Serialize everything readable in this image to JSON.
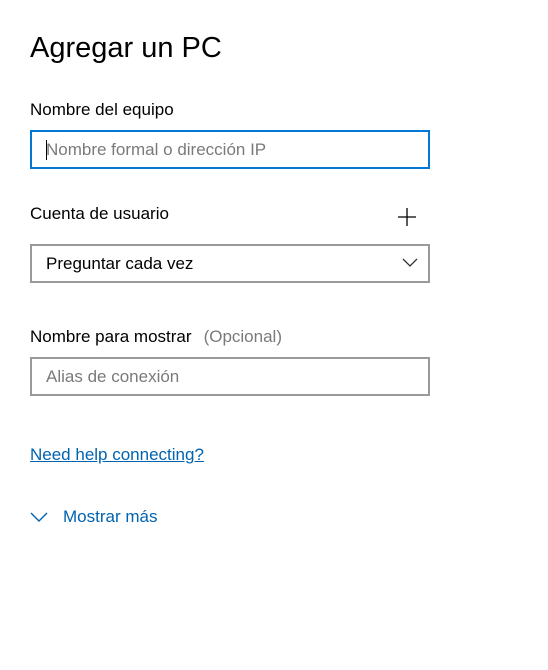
{
  "page": {
    "title": "Agregar un PC"
  },
  "pc_name": {
    "label": "Nombre del equipo",
    "placeholder": "Nombre formal o dirección IP",
    "value": ""
  },
  "account": {
    "label": "Cuenta de usuario",
    "add_icon": "plus-icon",
    "selected": "Preguntar cada vez",
    "dropdown_icon": "chevron-down-icon"
  },
  "display_name": {
    "label": "Nombre para mostrar",
    "optional": "(Opcional)",
    "placeholder": "Alias de conexión",
    "value": ""
  },
  "help_link": "Need help connecting?",
  "show_more": {
    "label": "Mostrar más",
    "icon": "chevron-down-icon"
  },
  "colors": {
    "accent": "#0078d7",
    "link": "#0063b1",
    "border": "#999999",
    "placeholder": "#7a7a7a"
  }
}
